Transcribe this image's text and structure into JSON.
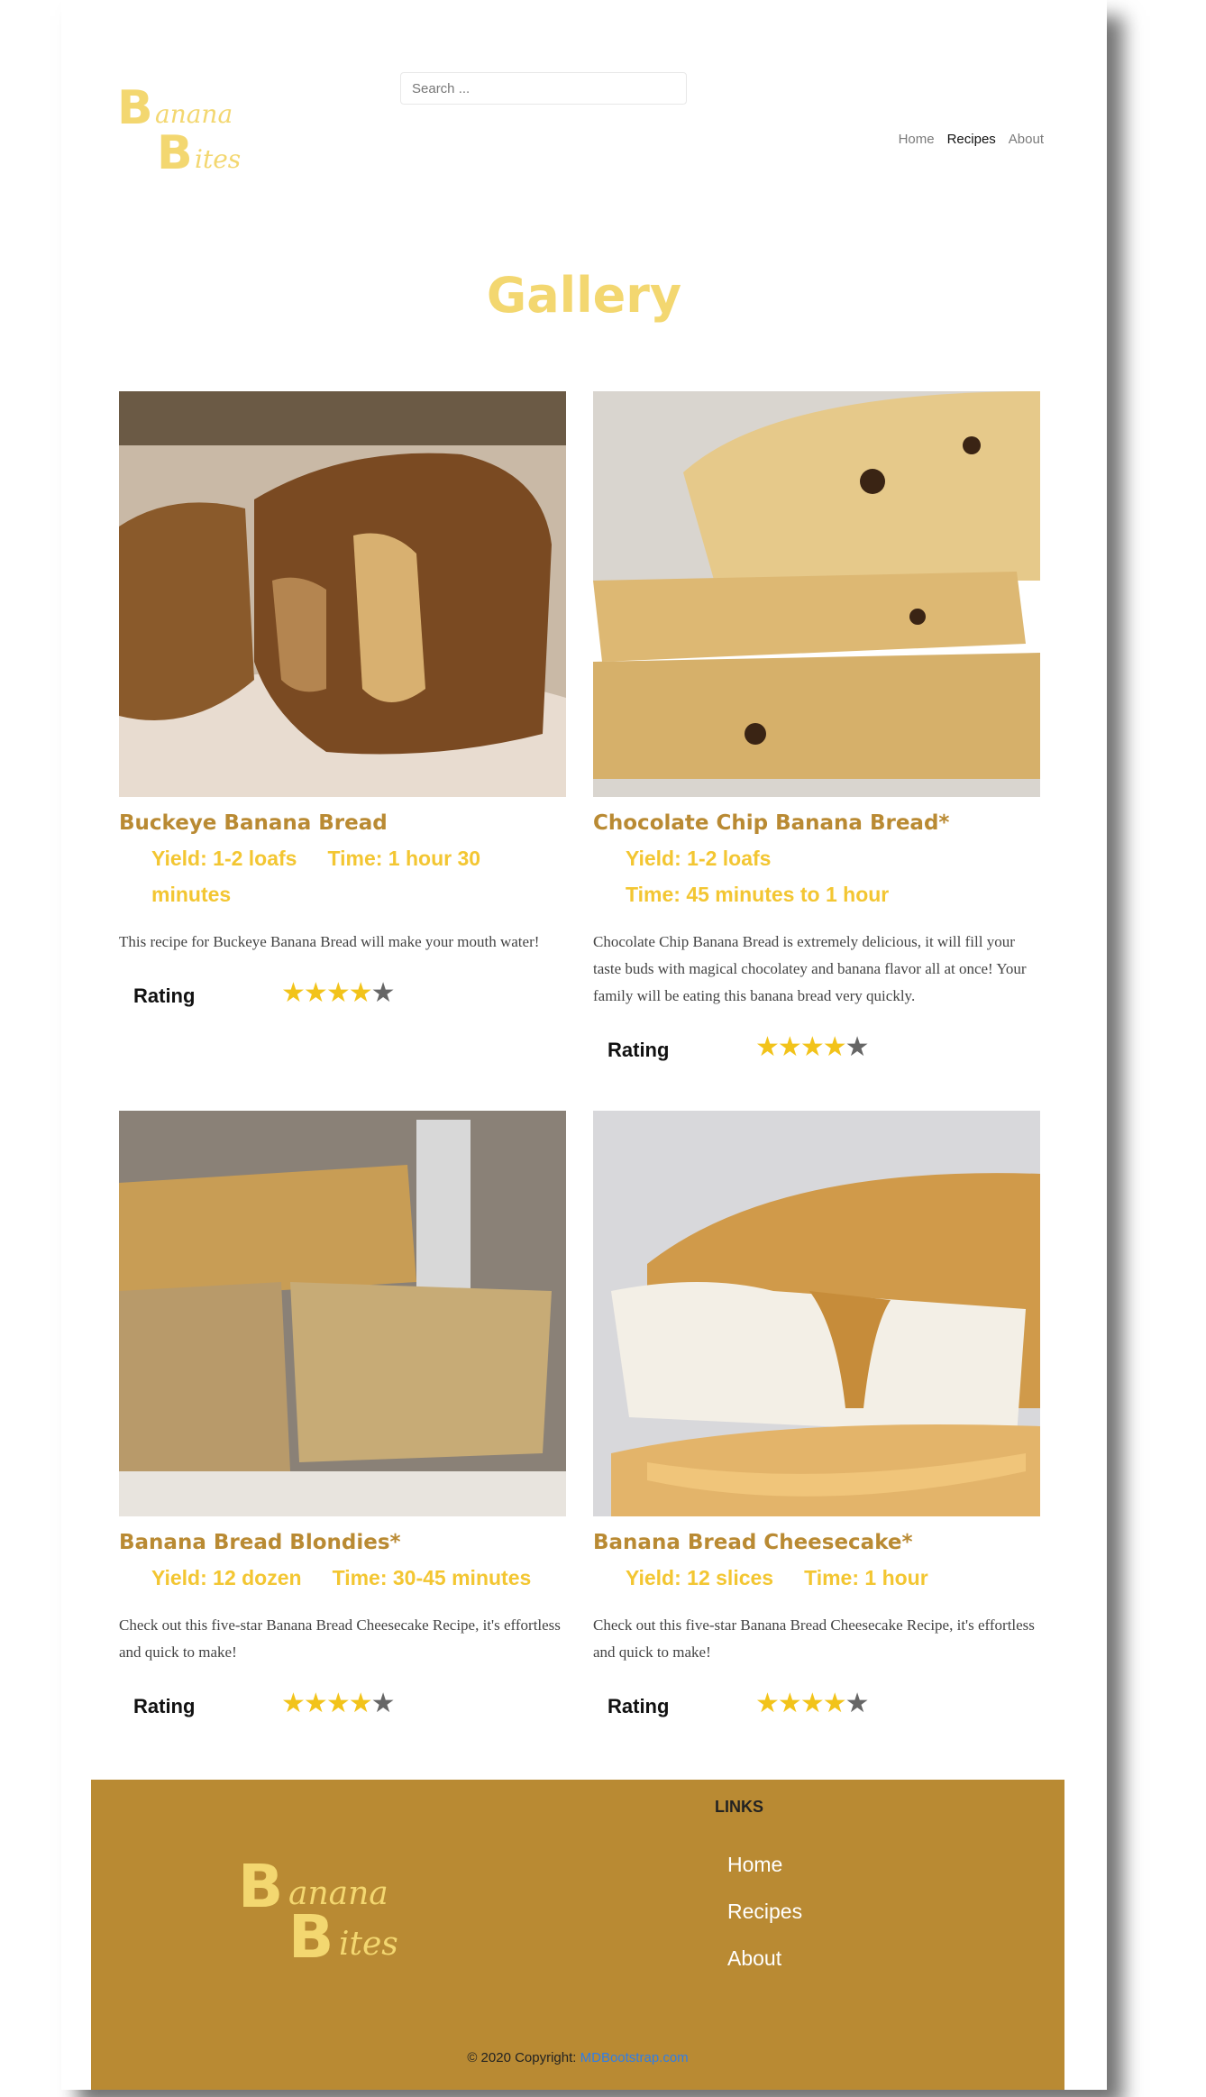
{
  "header": {
    "logo": {
      "first": "B",
      "first_rest": "anana",
      "second": "B",
      "second_rest": "ites"
    },
    "search_placeholder": "Search ...",
    "nav": [
      {
        "label": "Home",
        "active": false
      },
      {
        "label": "Recipes",
        "active": true
      },
      {
        "label": "About",
        "active": false
      }
    ]
  },
  "title": "Gallery",
  "cards": [
    {
      "name": "Buckeye Banana Bread",
      "yield": "Yield: 1-2 loafs",
      "time": "Time: 1 hour 30 minutes",
      "description": "This recipe for Buckeye Banana Bread will make your mouth water!",
      "rating_label": "Rating",
      "rating": 4,
      "rating_max": 5
    },
    {
      "name": "Chocolate Chip Banana Bread*",
      "yield": "Yield: 1-2 loafs",
      "time": "Time: 45 minutes to 1 hour",
      "description": "Chocolate Chip Banana Bread is extremely delicious, it will fill your taste buds with magical chocolatey and banana flavor all at once! Your family will be eating this banana bread very quickly.",
      "rating_label": "Rating",
      "rating": 4,
      "rating_max": 5
    },
    {
      "name": "Banana Bread Blondies*",
      "yield": "Yield: 12 dozen",
      "time": "Time: 30-45 minutes",
      "description": "Check out this five-star Banana Bread Cheesecake Recipe, it's effortless and quick to make!",
      "rating_label": "Rating",
      "rating": 4,
      "rating_max": 5
    },
    {
      "name": "Banana Bread Cheesecake*",
      "yield": "Yield: 12 slices",
      "time": "Time: 1 hour",
      "description": "Check out this five-star Banana Bread Cheesecake Recipe, it's effortless and quick to make!",
      "rating_label": "Rating",
      "rating": 4,
      "rating_max": 5
    }
  ],
  "footer": {
    "links_title": "LINKS",
    "links": [
      "Home",
      "Recipes",
      "About"
    ],
    "copyright_prefix": "© 2020 Copyright:",
    "copyright_link": "MDBootstrap.com"
  },
  "colors": {
    "brand_yellow": "#f3d770",
    "brand_gold": "#b98a33",
    "meta_yellow": "#f3c632",
    "star_on": "#f2c31a",
    "star_off": "#666666"
  }
}
